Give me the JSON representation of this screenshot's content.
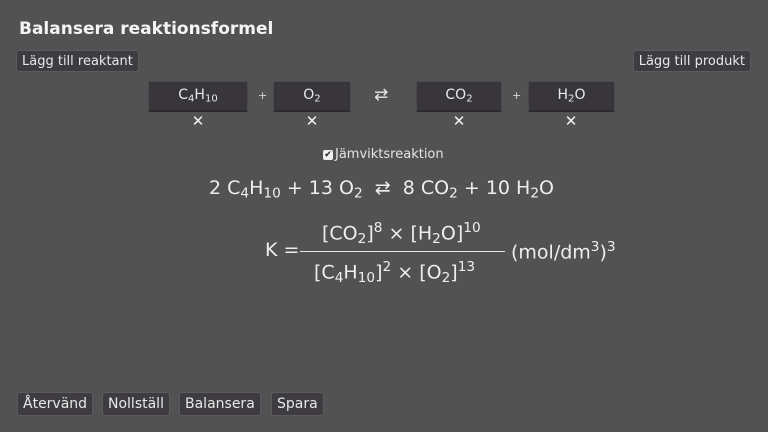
{
  "title": "Balansera reaktionsformel",
  "buttons": {
    "add_reactant": "Lägg till reaktant",
    "add_product": "Lägg till produkt"
  },
  "species": {
    "reactant1": {
      "main": "C",
      "s1": "4",
      "m2": "H",
      "s2": "10"
    },
    "reactant2": {
      "main": "O",
      "s1": "2"
    },
    "product1": {
      "main": "CO",
      "s1": "2"
    },
    "product2": {
      "main": "H",
      "s1": "2",
      "m2": "O"
    }
  },
  "remove_symbol": "✕",
  "plus": "+",
  "arrow": "⇄",
  "equilibrium": {
    "checked": true,
    "check_mark": "✔",
    "label": "Jämviktsreaktion"
  },
  "equation": {
    "c1": "2 C",
    "c1s": "4",
    "c1m": "H",
    "c1s2": "10",
    "plus1": " + 13 O",
    "o2s": "2",
    "arrow": "  ⇄  ",
    "p1": "8 CO",
    "p1s": "2",
    "plus2": " + 10 H",
    "p2s": "2",
    "p2m": "O"
  },
  "k_expression": {
    "lhs": "K =",
    "num_a": "[CO",
    "num_a_sub": "2",
    "num_a_close": "]",
    "num_a_exp": "8",
    "times": " × ",
    "num_b": "[H",
    "num_b_sub": "2",
    "num_b_mid": "O]",
    "num_b_exp": "10",
    "den_a": "[C",
    "den_a_sub": "4",
    "den_a_mid": "H",
    "den_a_sub2": "10",
    "den_a_close": "]",
    "den_a_exp": "2",
    "den_b": "[O",
    "den_b_sub": "2",
    "den_b_close": "]",
    "den_b_exp": "13",
    "unit_open": "(mol/dm",
    "unit_exp": "3",
    "unit_close": ")",
    "unit_pow": "3"
  },
  "bottom_buttons": {
    "back": "Återvänd",
    "reset": "Nollställ",
    "balance": "Balansera",
    "save": "Spara"
  }
}
